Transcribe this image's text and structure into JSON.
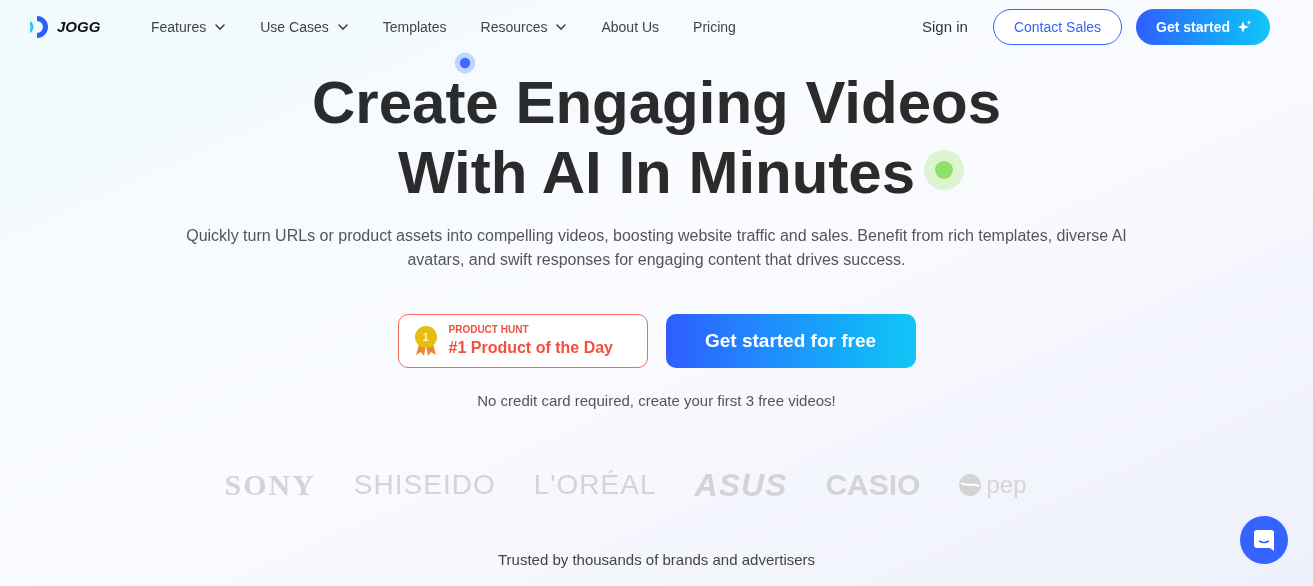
{
  "brand": {
    "name": "JOGG"
  },
  "nav": {
    "items": [
      {
        "label": "Features",
        "dropdown": true
      },
      {
        "label": "Use Cases",
        "dropdown": true
      },
      {
        "label": "Templates",
        "dropdown": false
      },
      {
        "label": "Resources",
        "dropdown": true
      },
      {
        "label": "About Us",
        "dropdown": false
      },
      {
        "label": "Pricing",
        "dropdown": false
      }
    ],
    "sign_in": "Sign in",
    "contact_sales": "Contact Sales",
    "get_started": "Get started"
  },
  "hero": {
    "title_lines": [
      "Create Engaging Videos",
      "With AI In Minutes"
    ],
    "subtitle": "Quickly turn URLs or product assets into compelling videos, boosting website traffic and sales. Benefit from rich templates, diverse AI avatars, and swift responses for engaging content that drives success.",
    "award": {
      "badge": "1",
      "kicker": "PRODUCT HUNT",
      "label": "#1 Product of the Day"
    },
    "cta": "Get started for free",
    "note": "No credit card required, create your first 3 free videos!"
  },
  "brand_logos": [
    {
      "text": "SONY",
      "kind": "serif"
    },
    {
      "text": "SHISEIDO",
      "kind": "light"
    },
    {
      "text": "L'ORÉAL",
      "kind": "light"
    },
    {
      "text": "ASUS",
      "kind": "italic"
    },
    {
      "text": "CASIO",
      "kind": "heavy"
    },
    {
      "text": "pep",
      "kind": "globe"
    }
  ],
  "trusted": "Trusted by thousands of brands and advertisers"
}
